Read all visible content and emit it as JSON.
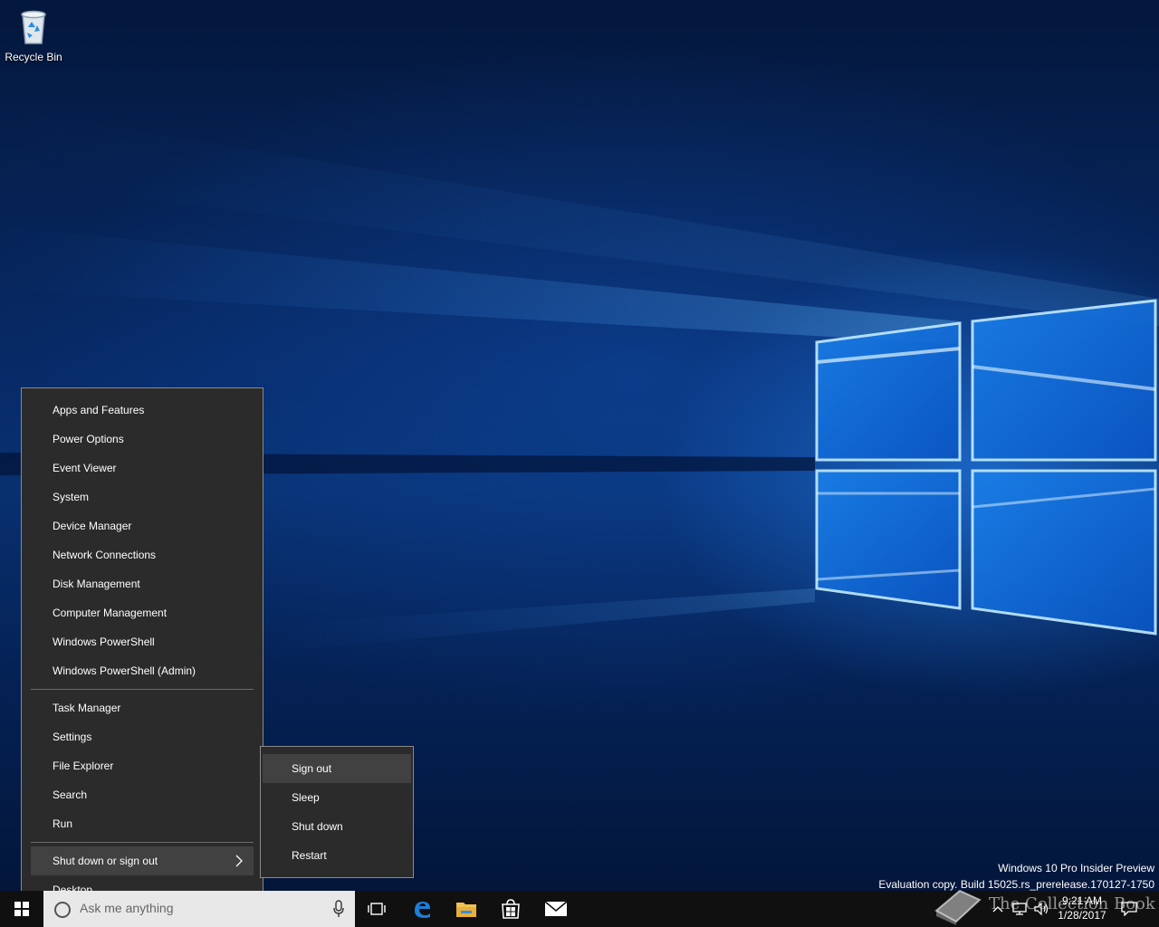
{
  "desktop": {
    "icons": [
      {
        "label": "Recycle Bin",
        "icon": "recycle-bin-icon"
      }
    ]
  },
  "winx_menu": {
    "group1": [
      "Apps and Features",
      "Power Options",
      "Event Viewer",
      "System",
      "Device Manager",
      "Network Connections",
      "Disk Management",
      "Computer Management",
      "Windows PowerShell",
      "Windows PowerShell (Admin)"
    ],
    "group2": [
      "Task Manager",
      "Settings",
      "File Explorer",
      "Search",
      "Run"
    ],
    "shutdown": "Shut down or sign out",
    "desktop": "Desktop"
  },
  "submenu": {
    "items": [
      "Sign out",
      "Sleep",
      "Shut down",
      "Restart"
    ],
    "hovered": "Sign out"
  },
  "watermark": {
    "line1": "Windows 10 Pro Insider Preview",
    "line2": "Evaluation copy. Build 15025.rs_prerelease.170127-1750"
  },
  "taskbar": {
    "search_placeholder": "Ask me anything",
    "pinned": [
      "task-view-icon",
      "edge-icon",
      "file-explorer-icon",
      "store-icon",
      "mail-icon"
    ],
    "tray_icons": [
      "chevron-up-icon",
      "network-icon",
      "volume-icon"
    ],
    "time": "9:21 AM",
    "date": "1/28/2017",
    "overlay_text": "The Collection Book"
  },
  "colors": {
    "menu_bg": "#2b2b2b",
    "menu_hover": "#414141",
    "taskbar_bg": "#101010",
    "accent": "#0078d7"
  }
}
